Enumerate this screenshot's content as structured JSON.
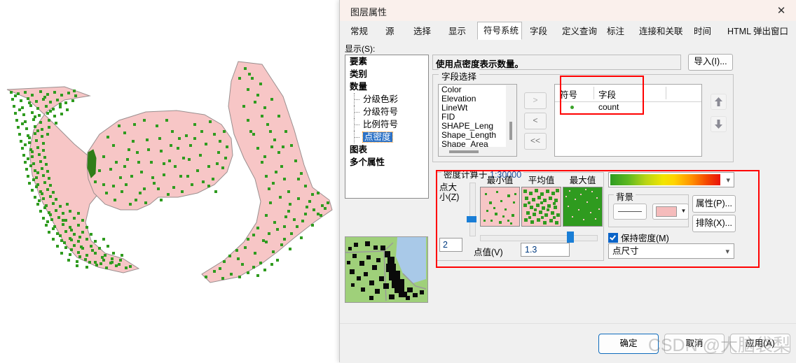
{
  "window": {
    "title": "图层属性",
    "close_icon": "close-icon"
  },
  "tabs": [
    {
      "label": "常规",
      "active": false
    },
    {
      "label": "源",
      "active": false
    },
    {
      "label": "选择",
      "active": false
    },
    {
      "label": "显示",
      "active": false
    },
    {
      "label": "符号系统",
      "active": true
    },
    {
      "label": "字段",
      "active": false
    },
    {
      "label": "定义查询",
      "active": false
    },
    {
      "label": "标注",
      "active": false
    },
    {
      "label": "连接和关联",
      "active": false
    },
    {
      "label": "时间",
      "active": false
    },
    {
      "label": "HTML 弹出窗口",
      "active": false
    }
  ],
  "sidebar": {
    "label": "显示(S):",
    "items": [
      {
        "label": "要素",
        "level": 0,
        "selected": false
      },
      {
        "label": "类别",
        "level": 0,
        "selected": false
      },
      {
        "label": "数量",
        "level": 0,
        "selected": false
      },
      {
        "label": "分级色彩",
        "level": 1,
        "selected": false
      },
      {
        "label": "分级符号",
        "level": 1,
        "selected": false
      },
      {
        "label": "比例符号",
        "level": 1,
        "selected": false
      },
      {
        "label": "点密度",
        "level": 1,
        "selected": true
      },
      {
        "label": "图表",
        "level": 0,
        "selected": false
      },
      {
        "label": "多个属性",
        "level": 0,
        "selected": false
      }
    ]
  },
  "description": "使用点密度表示数量。",
  "import_button": "导入(I)...",
  "field_selection": {
    "group_title": "字段选择",
    "available_fields": [
      "Color",
      "Elevation",
      "LineWt",
      "FID",
      "SHAPE_Leng",
      "Shape_Length",
      "Shape_Area"
    ],
    "transfer_buttons": [
      ">",
      "<",
      "<<"
    ],
    "table": {
      "columns": [
        "符号",
        "字段"
      ],
      "rows": [
        {
          "symbol": "green-dot",
          "field": "count"
        }
      ]
    },
    "move_up_icon": "arrow-up-icon",
    "move_down_icon": "arrow-down-icon"
  },
  "density": {
    "group_title": "密度计算于",
    "scale": "1:30000",
    "point_size_label": "点大小(Z)",
    "point_size_value": "2",
    "swatches": [
      {
        "caption": "最小值"
      },
      {
        "caption": "平均值"
      },
      {
        "caption": "最大值"
      }
    ],
    "point_value_label": "点值(V)",
    "point_value": "1.3"
  },
  "appearance": {
    "color_ramp": {
      "name": "green-yellow-red-ramp",
      "stops": [
        "#2e9c22",
        "#b8d415",
        "#f2e500",
        "#ff9000",
        "#e8120a"
      ]
    },
    "background_group": "背景",
    "background_outline_icon": "line-style-swatch",
    "background_fill_color": "#f5bcbc",
    "properties_button": "属性(P)...",
    "exclusion_button": "排除(X)...",
    "maintain_density_label": "保持密度(M)",
    "maintain_density_checked": true,
    "point_size_combo": "点尺寸"
  },
  "footer": {
    "ok": "确定",
    "cancel": "取消",
    "apply": "应用(A)"
  },
  "watermark": "CSDN @大脑袋梨",
  "map": {
    "polygon_fill": "#f7c6c6",
    "polygon_stroke": "#9a8f8f",
    "dot_color": "#2f9b1f",
    "preview_land": "#9fd07a",
    "preview_water": "#a9c9e8"
  }
}
